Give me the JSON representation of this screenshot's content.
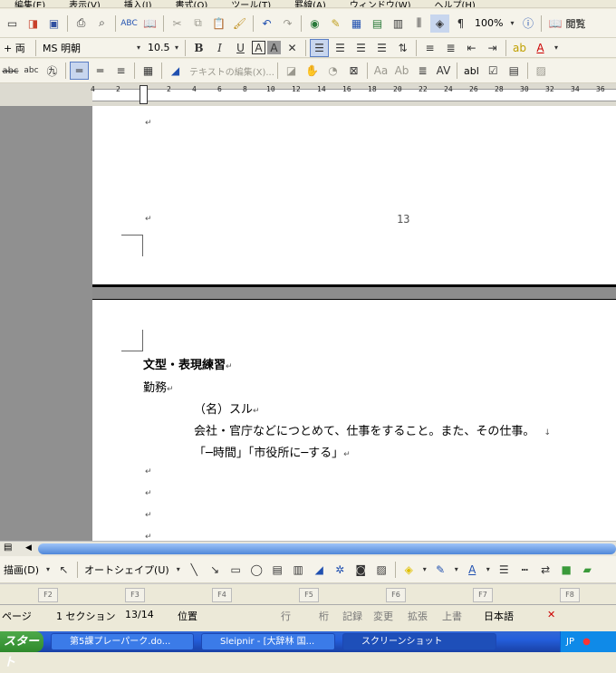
{
  "menu": [
    "編集(E)",
    "表示(V)",
    "挿入(I)",
    "書式(O)",
    "ツール(T)",
    "罫線(A)",
    "ウィンドウ(W)",
    "ヘルプ(H)"
  ],
  "toolbar1": {
    "zoom": "100%",
    "reading_label": "閲覧"
  },
  "toolbar2": {
    "style": "+ 両",
    "font_name": "MS 明朝",
    "font_size": "10.5",
    "bold": "B",
    "italic": "I",
    "underline": "U",
    "char_border": "A",
    "char_shade": "A",
    "font_color": "A"
  },
  "toolbar3": {
    "textbox_label": "テキストの編集(X)...",
    "abl": "abl"
  },
  "ruler": {
    "ticks": [
      "4",
      "2",
      "2",
      "4",
      "6",
      "8",
      "10",
      "12",
      "14",
      "16",
      "18",
      "20",
      "22",
      "24",
      "26",
      "28",
      "30",
      "32",
      "34",
      "36"
    ]
  },
  "document": {
    "page_number": "13",
    "title": "文型・表現練習",
    "term": "勤務",
    "pos": "（名）スル",
    "definition": "会社・官庁などにつとめて、仕事をすること。また、その仕事。",
    "example": "「─時間」「市役所に─する」",
    "para_mark": "↵",
    "line_break": "↓"
  },
  "drawing": {
    "draw_menu": "描画(D)",
    "autoshape": "オートシェイプ(U)"
  },
  "fkeys": [
    "F2",
    "F3",
    "F4",
    "F5",
    "F6",
    "F7",
    "F8"
  ],
  "status": {
    "page": "ページ",
    "section": "1 セクション",
    "pages": "13/14",
    "position": "位置",
    "line": "行",
    "column": "桁",
    "rec": "記録",
    "trk": "変更",
    "ext": "拡張",
    "ovr": "上書",
    "language": "日本語"
  },
  "taskbar": {
    "start": "スタート",
    "tasks": [
      "第5課プレーパーク.do...",
      "Sleipnir - [大辞林 国...",
      "スクリーンショット"
    ],
    "tray_lang": "JP"
  },
  "colors": {
    "taskbar": "#245edb",
    "canvas": "#8d8d8d"
  }
}
